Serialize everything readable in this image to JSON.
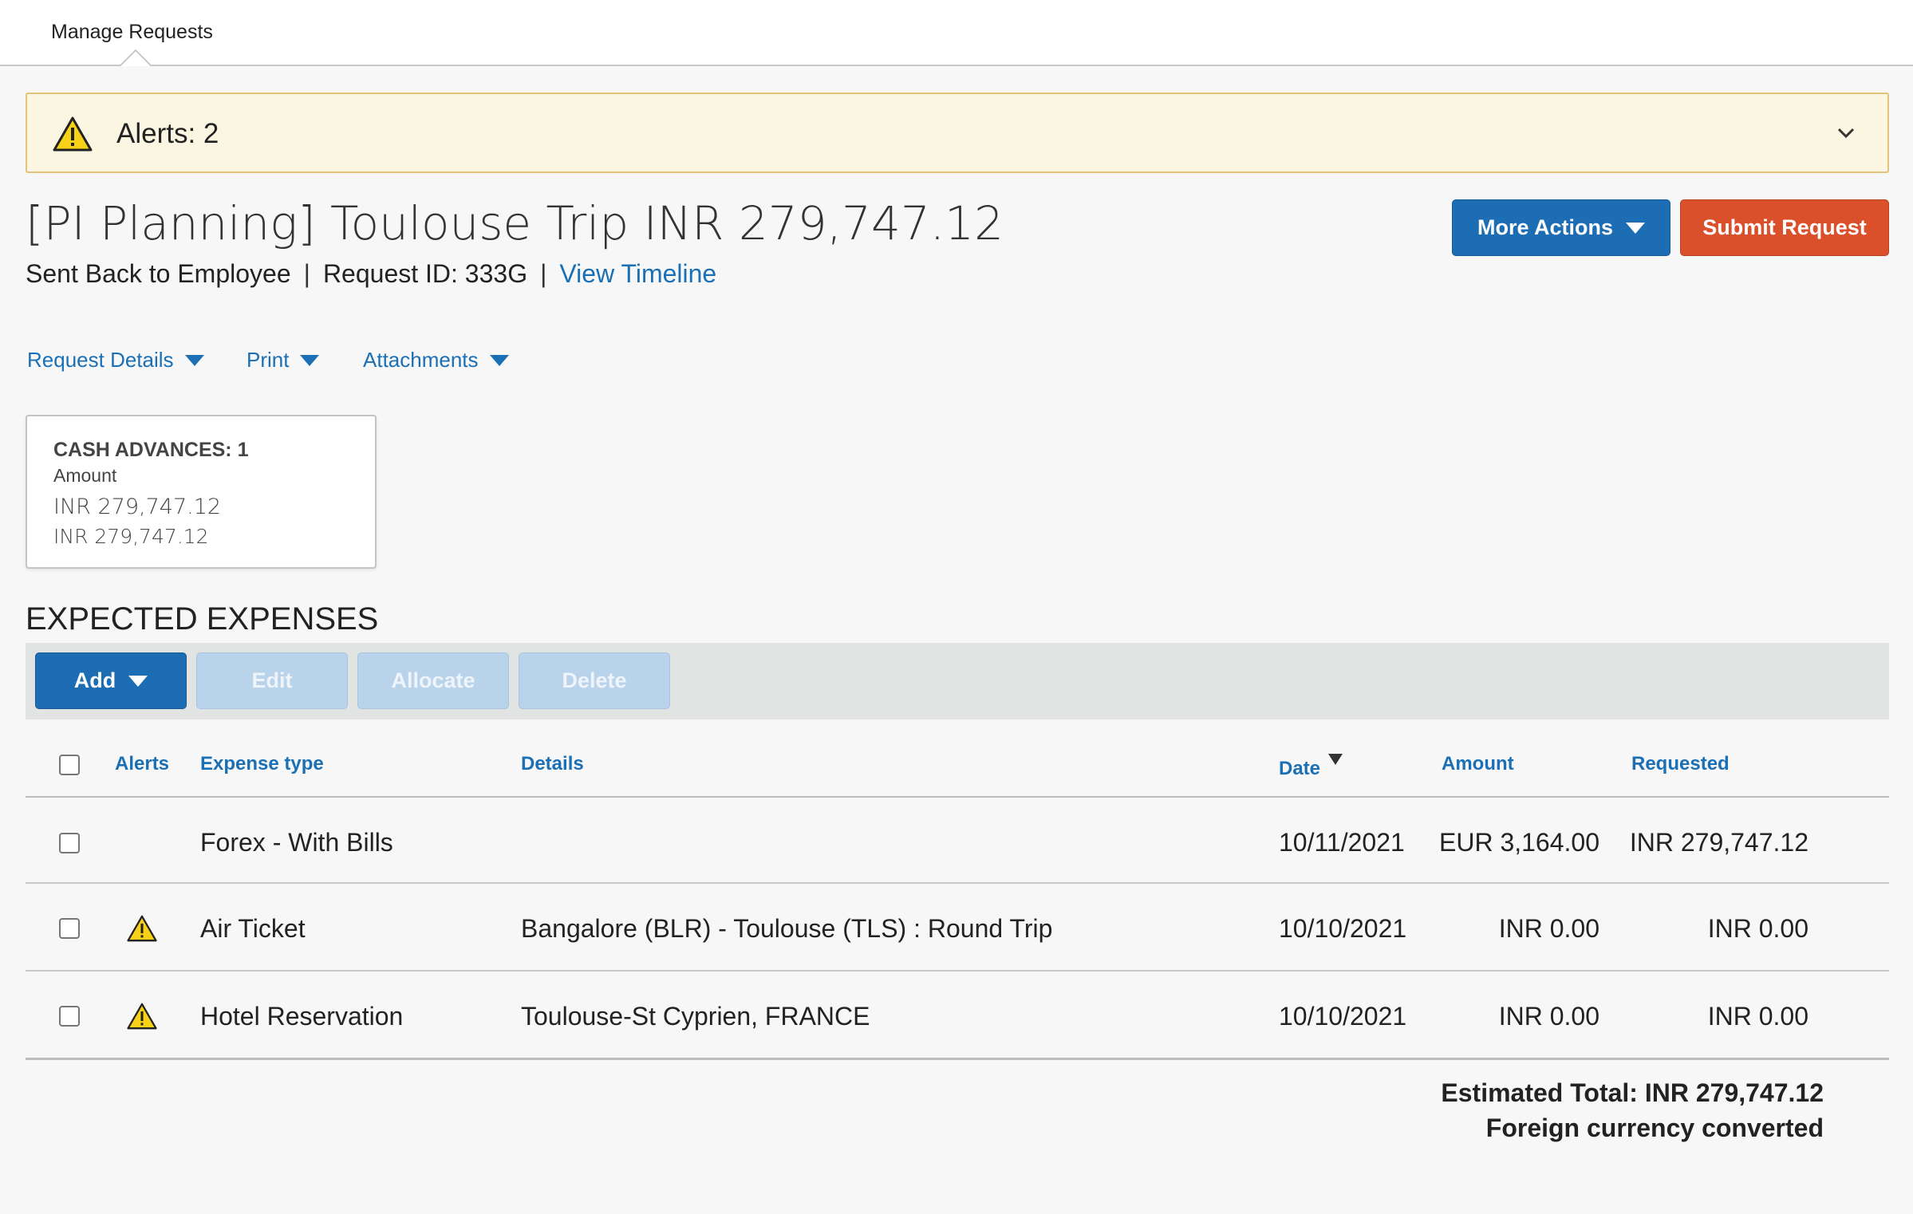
{
  "nav": {
    "tab_label": "Manage Requests"
  },
  "alerts": {
    "label": "Alerts: 2"
  },
  "header": {
    "title": "[PI Planning] Toulouse Trip INR 279,747.12",
    "status": "Sent Back to Employee",
    "separator": "|",
    "request_id": "Request ID: 333G",
    "timeline_link": "View Timeline",
    "more_actions": "More Actions",
    "submit": "Submit Request"
  },
  "menu": {
    "request_details": "Request Details",
    "print": "Print",
    "attachments": "Attachments"
  },
  "cash_advances": {
    "heading": "CASH ADVANCES: 1",
    "label": "Amount",
    "amount_1": "INR 279,747.12",
    "amount_2": "INR 279,747.12"
  },
  "expenses": {
    "title": "EXPECTED EXPENSES",
    "toolbar": {
      "add": "Add",
      "edit": "Edit",
      "allocate": "Allocate",
      "delete": "Delete"
    },
    "columns": {
      "alerts": "Alerts",
      "expense_type": "Expense type",
      "details": "Details",
      "date": "Date",
      "amount": "Amount",
      "requested": "Requested"
    },
    "rows": [
      {
        "alert": false,
        "type": "Forex - With Bills",
        "details": "",
        "date": "10/11/2021",
        "amount": "EUR 3,164.00",
        "requested": "INR 279,747.12"
      },
      {
        "alert": true,
        "type": "Air Ticket",
        "details": "Bangalore (BLR) - Toulouse (TLS) : Round Trip",
        "date": "10/10/2021",
        "amount": "INR 0.00",
        "requested": "INR 0.00"
      },
      {
        "alert": true,
        "type": "Hotel Reservation",
        "details": "Toulouse-St Cyprien, FRANCE",
        "date": "10/10/2021",
        "amount": "INR 0.00",
        "requested": "INR 0.00"
      }
    ],
    "estimated_total": "Estimated Total: INR 279,747.12",
    "currency_note": "Foreign currency converted"
  },
  "colors": {
    "link": "#1a6fb5",
    "primary": "#1d6db5",
    "submit": "#d9502a",
    "alert_bg": "#faf6e1",
    "warning": "#f7d117"
  },
  "icons": [
    "warning-icon",
    "chevron-down-icon",
    "caret-down-icon",
    "sort-desc-icon"
  ]
}
